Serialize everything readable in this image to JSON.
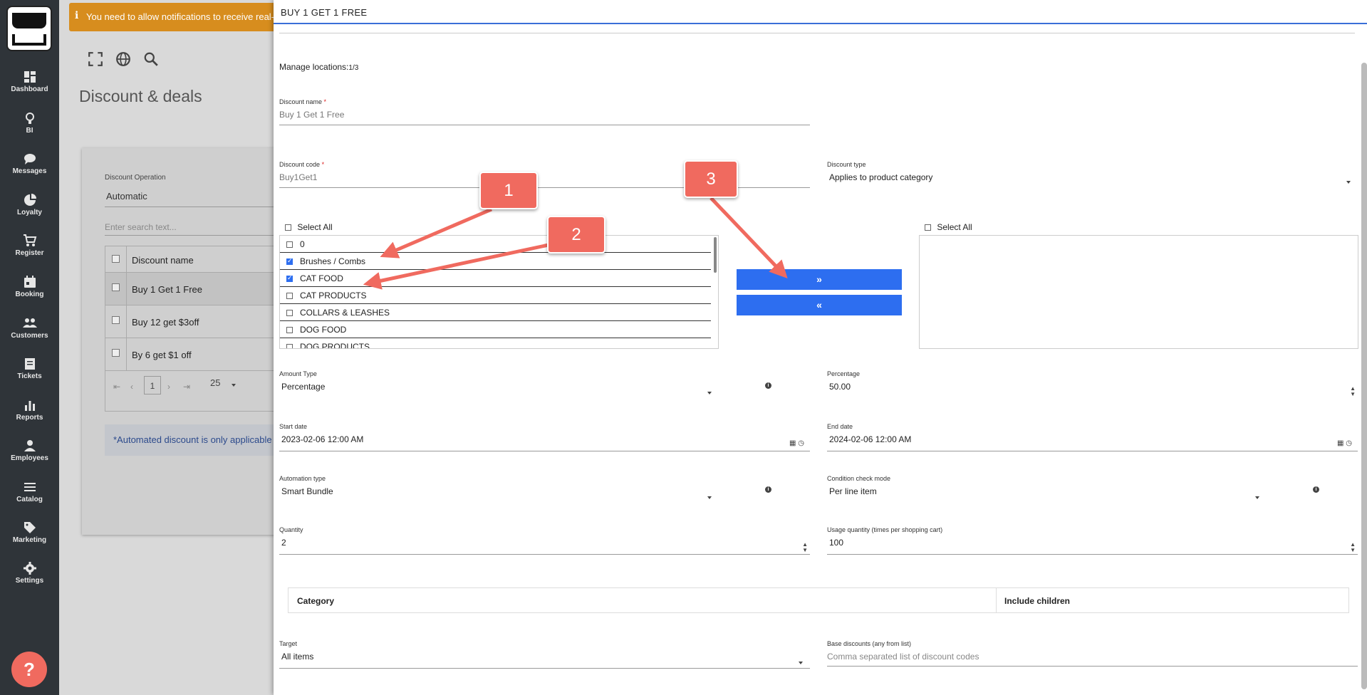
{
  "sidebar": {
    "items": [
      {
        "label": "Dashboard",
        "icon": "dashboard-icon"
      },
      {
        "label": "BI",
        "icon": "lightbulb-icon"
      },
      {
        "label": "Messages",
        "icon": "chat-icon"
      },
      {
        "label": "Loyalty",
        "icon": "pie-icon"
      },
      {
        "label": "Register",
        "icon": "cart-icon"
      },
      {
        "label": "Booking",
        "icon": "calendar-icon"
      },
      {
        "label": "Customers",
        "icon": "people-icon"
      },
      {
        "label": "Tickets",
        "icon": "ticket-icon"
      },
      {
        "label": "Reports",
        "icon": "bar-chart-icon"
      },
      {
        "label": "Employees",
        "icon": "person-icon"
      },
      {
        "label": "Catalog",
        "icon": "list-icon"
      },
      {
        "label": "Marketing",
        "icon": "tag-icon"
      },
      {
        "label": "Settings",
        "icon": "gear-icon"
      }
    ],
    "help_label": "?"
  },
  "background": {
    "notification": "You need to allow notifications to receive real-time",
    "notification_icon": "ℹ",
    "page_title": "Discount & deals",
    "operation_label": "Discount Operation",
    "operation_value": "Automatic",
    "search_placeholder": "Enter search text...",
    "table_header": "Discount name",
    "rows": [
      "Buy 1 Get 1 Free",
      "Buy 12 get $3off",
      "By 6 get $1 off"
    ],
    "pager_page": "1",
    "pager_size": "25",
    "info_text": "*Automated discount is only applicable"
  },
  "panel": {
    "title": "BUY 1 GET 1 FREE",
    "manage_label": "Manage locations:",
    "manage_count": "1/3",
    "discount_name_label": "Discount name",
    "discount_name_value": "Buy 1 Get 1 Free",
    "discount_code_label": "Discount code",
    "discount_code_value": "Buy1Get1",
    "discount_type_label": "Discount type",
    "discount_type_value": "Applies to product category",
    "select_all_label": "Select All",
    "left_list": [
      {
        "label": "0",
        "checked": false
      },
      {
        "label": "Brushes / Combs",
        "checked": true
      },
      {
        "label": "CAT FOOD",
        "checked": true
      },
      {
        "label": "CAT PRODUCTS",
        "checked": false
      },
      {
        "label": "COLLARS & LEASHES",
        "checked": false
      },
      {
        "label": "DOG FOOD",
        "checked": false
      },
      {
        "label": "DOG PRODUCTS",
        "checked": false
      }
    ],
    "move_right_label": "»",
    "move_left_label": "«",
    "amount_type_label": "Amount Type",
    "amount_type_value": "Percentage",
    "percentage_label": "Percentage",
    "percentage_value": "50.00",
    "start_date_label": "Start date",
    "start_date_value": "2023-02-06 12:00 AM",
    "end_date_label": "End date",
    "end_date_value": "2024-02-06 12:00 AM",
    "automation_type_label": "Automation type",
    "automation_type_value": "Smart Bundle",
    "condition_mode_label": "Condition check mode",
    "condition_mode_value": "Per line item",
    "quantity_label": "Quantity",
    "quantity_value": "2",
    "usage_quantity_label": "Usage quantity (times per shopping cart)",
    "usage_quantity_value": "100",
    "category_col": "Category",
    "include_children_col": "Include children",
    "target_label": "Target",
    "target_value": "All items",
    "base_discounts_label": "Base discounts (any from list)",
    "base_discounts_placeholder": "Comma separated list of discount codes"
  },
  "callouts": [
    "1",
    "2",
    "3"
  ],
  "colors": {
    "accent": "#2d6ef0",
    "callout": "#f06a5f",
    "sidebar": "#2f3439",
    "notification": "#d78d1e"
  }
}
